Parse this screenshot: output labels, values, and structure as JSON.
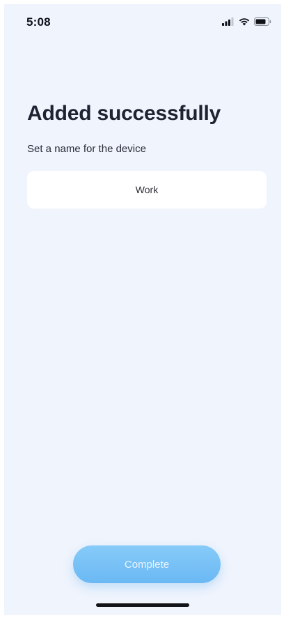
{
  "status_bar": {
    "time": "5:08",
    "icons": [
      "cellular-signal-icon",
      "wifi-icon",
      "battery-icon"
    ]
  },
  "main": {
    "title": "Added successfully",
    "subtitle": "Set a name for the device",
    "device_name_value": "Work"
  },
  "footer": {
    "complete_label": "Complete"
  },
  "colors": {
    "background": "#eff4fd",
    "field_background": "#ffffff",
    "button_accent": "#79c1f6",
    "title_text": "#1f2231"
  }
}
